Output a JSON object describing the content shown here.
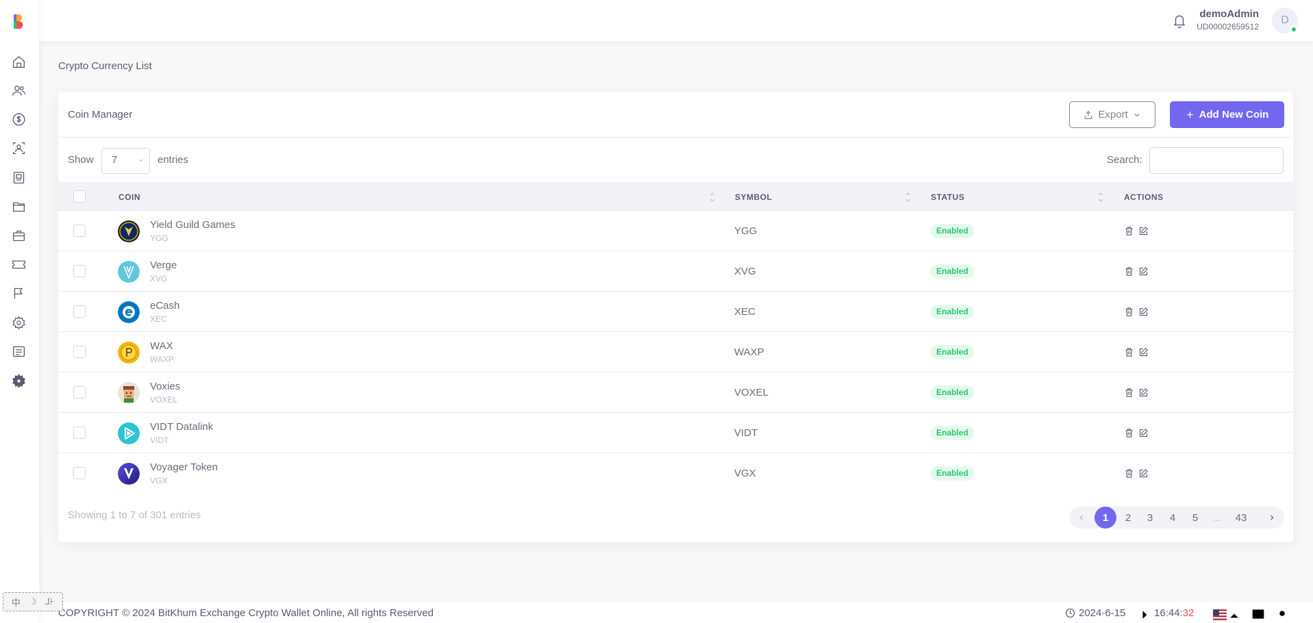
{
  "header": {
    "user_name": "demoAdmin",
    "user_id": "UD00002659512",
    "avatar_initial": "D"
  },
  "page": {
    "title": "Crypto Currency List"
  },
  "card": {
    "title": "Coin Manager",
    "export_label": "Export",
    "add_label": "Add New Coin",
    "show_label": "Show",
    "show_value": "7",
    "entries_label": "entries",
    "search_label": "Search:"
  },
  "table": {
    "columns": [
      "COIN",
      "SYMBOL",
      "STATUS",
      "ACTIONS"
    ],
    "rows": [
      {
        "name": "Yield Guild Games",
        "sub": "YGG",
        "symbol": "YGG",
        "status": "Enabled"
      },
      {
        "name": "Verge",
        "sub": "XVG",
        "symbol": "XVG",
        "status": "Enabled"
      },
      {
        "name": "eCash",
        "sub": "XEC",
        "symbol": "XEC",
        "status": "Enabled"
      },
      {
        "name": "WAX",
        "sub": "WAXP",
        "symbol": "WAXP",
        "status": "Enabled"
      },
      {
        "name": "Voxies",
        "sub": "VOXEL",
        "symbol": "VOXEL",
        "status": "Enabled"
      },
      {
        "name": "VIDT Datalink",
        "sub": "VIDT",
        "symbol": "VIDT",
        "status": "Enabled"
      },
      {
        "name": "Voyager Token",
        "sub": "VGX",
        "symbol": "VGX",
        "status": "Enabled"
      }
    ]
  },
  "pagination": {
    "showing": "Showing 1 to 7 of 301 entries",
    "pages": [
      "1",
      "2",
      "3",
      "4",
      "5",
      "...",
      "43"
    ],
    "current": "1"
  },
  "footer": {
    "copyright": "COPYRIGHT © 2024 BitKhum Exchange Crypto Wallet Online, All rights Reserved",
    "date": "2024-6-15",
    "time_main": "16:44:",
    "time_sec": "32"
  },
  "tools": [
    "中",
    "☽",
    "⅃⊦"
  ],
  "colors": {
    "primary": "#7367f0",
    "success": "#28c76f",
    "danger": "#ea5455"
  },
  "icons": {
    "sidebar": [
      "home-icon",
      "users-icon",
      "dollar-icon",
      "user-card-icon",
      "ledger-icon",
      "folder-icon",
      "briefcase-icon",
      "ticket-icon",
      "flag-icon",
      "settings-icon",
      "news-icon",
      "gear-icon"
    ],
    "footer": [
      "clock-icon",
      "chevron-right-icon",
      "flag-us-icon",
      "chevron-up-icon",
      "window-icon",
      "sun-icon"
    ]
  }
}
